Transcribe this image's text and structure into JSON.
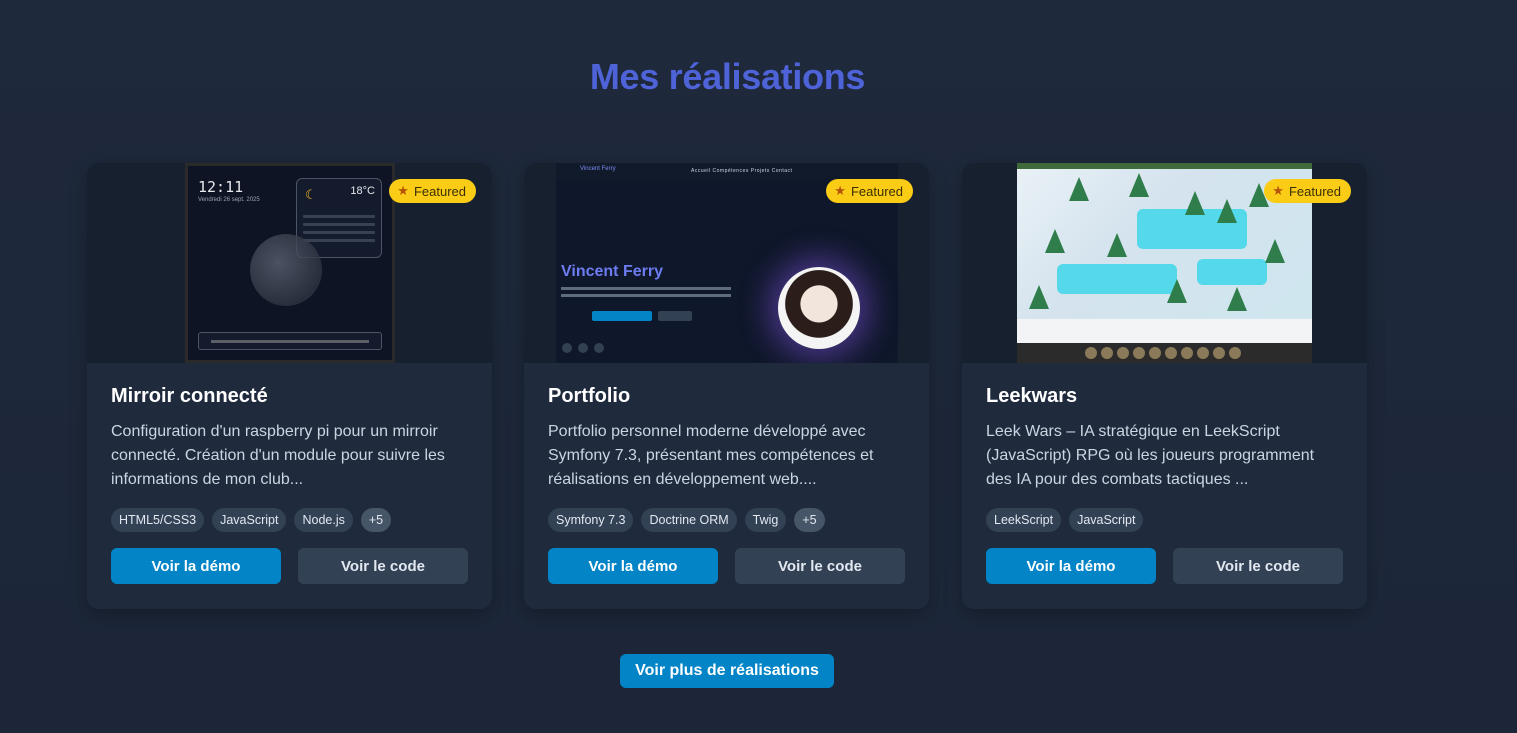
{
  "section": {
    "title": "Mes réalisations"
  },
  "badge_label": "Featured",
  "projects": [
    {
      "title": "Mirroir connecté",
      "description": "Configuration d'un raspberry pi pour un mirroir connecté. Création d'un module pour suivre les informations de mon club...",
      "tags": [
        "HTML5/CSS3",
        "JavaScript",
        "Node.js",
        "+5"
      ],
      "demo_label": "Voir la démo",
      "code_label": "Voir le code",
      "thumb": {
        "time": "12:11",
        "date": "Vendredi 26 sept. 2025",
        "temp": "18°C"
      }
    },
    {
      "title": "Portfolio",
      "description": "Portfolio personnel moderne développé avec Symfony 7.3, présentant mes compétences et réalisations en développement web....",
      "tags": [
        "Symfony 7.3",
        "Doctrine ORM",
        "Twig",
        "+5"
      ],
      "demo_label": "Voir la démo",
      "code_label": "Voir le code",
      "thumb": {
        "nav_name": "Vincent Ferry",
        "nav_links": "Accueil  Compétences  Projets  Contact",
        "hero_name": "Vincent Ferry"
      }
    },
    {
      "title": "Leekwars",
      "description": "Leek Wars – IA stratégique en LeekScript (JavaScript) RPG où les joueurs programment des IA pour des combats tactiques ...",
      "tags": [
        "LeekScript",
        "JavaScript"
      ],
      "demo_label": "Voir la démo",
      "code_label": "Voir le code"
    }
  ],
  "more_button": "Voir plus de réalisations",
  "colors": {
    "title": "#4f63d8",
    "primary": "#0284c7",
    "badge": "#facc15",
    "background": "#1e293b"
  },
  "icons": {
    "badge": "star-icon"
  }
}
